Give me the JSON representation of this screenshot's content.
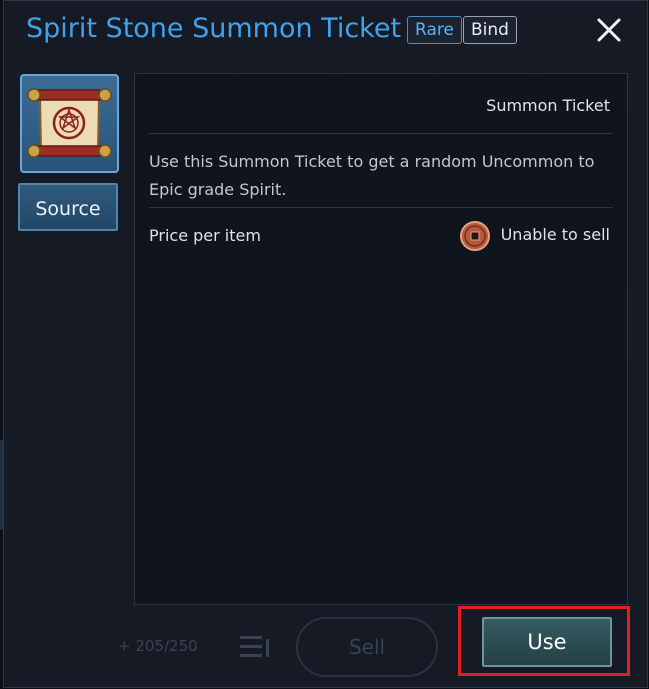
{
  "popup": {
    "title": "Spirit Stone Summon Ticket",
    "badges": [
      "Rare",
      "Bind"
    ],
    "close_icon": "close-icon"
  },
  "item": {
    "icon": "summon-scroll-icon",
    "source_label": "Source",
    "type": "Summon Ticket",
    "description": "Use this Summon Ticket to get a random Uncommon to Epic grade Spirit.",
    "price_label": "Price per item",
    "price_icon": "coin-icon",
    "sell_status": "Unable to sell"
  },
  "actions": {
    "use_label": "Use"
  },
  "background": {
    "inventory_count": "205/250",
    "sell_label": "Sell"
  },
  "colors": {
    "title": "#3fa2ec",
    "rare_badge": "#58b4f2",
    "use_button": "#2f5459",
    "highlight": "#e01e24"
  }
}
